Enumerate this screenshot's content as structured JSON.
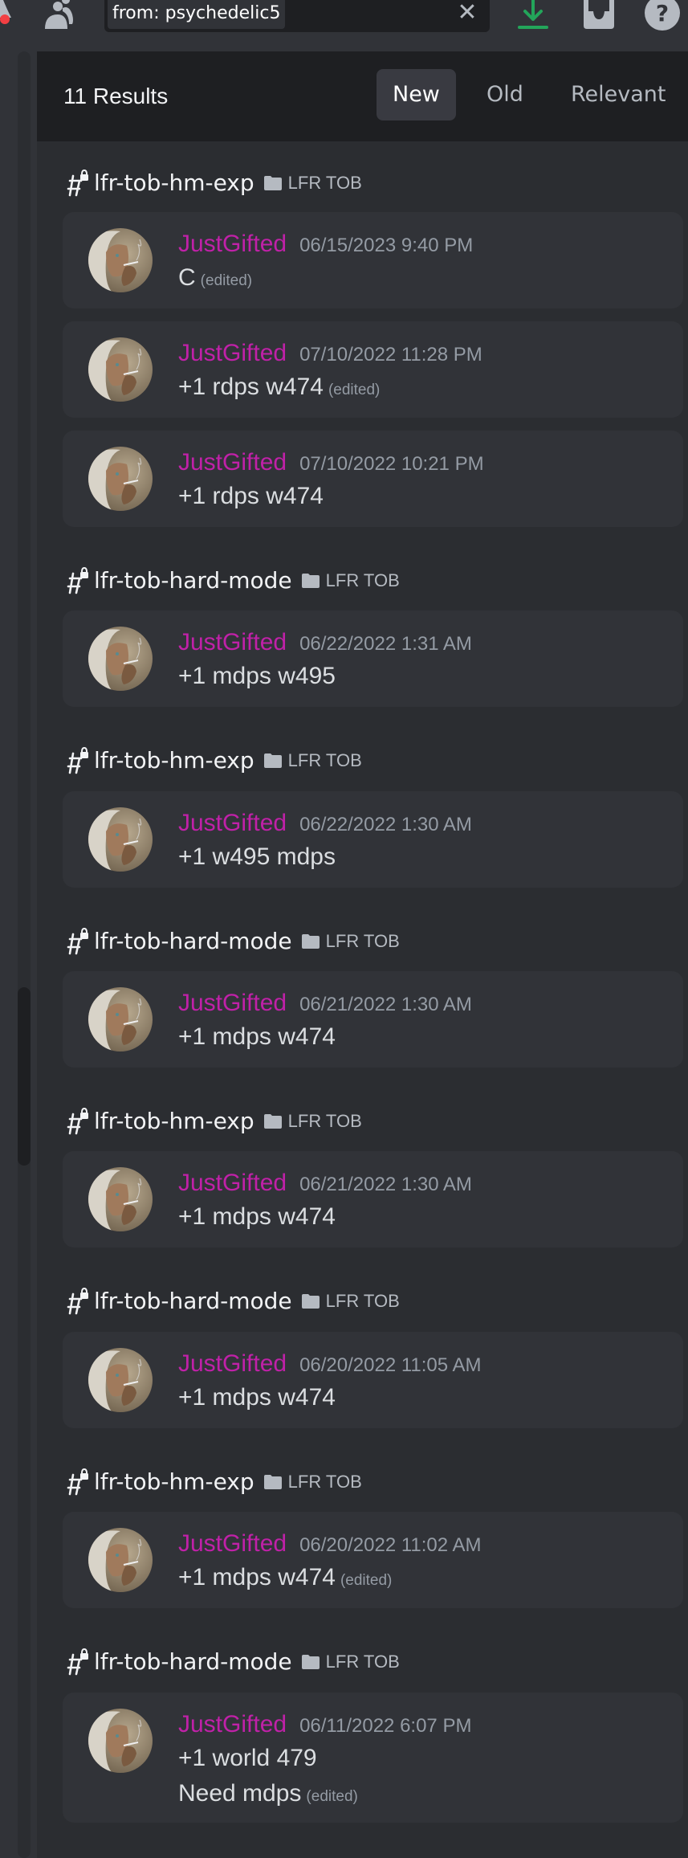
{
  "topbar": {
    "search_query": "from: psychedelic5",
    "clear_symbol": "✕",
    "icons": [
      "bell-icon",
      "members-icon",
      "download-icon",
      "inbox-icon",
      "help-icon"
    ]
  },
  "results": {
    "count_label": "11 Results",
    "sort_options": [
      {
        "label": "New",
        "active": true
      },
      {
        "label": "Old",
        "active": false
      },
      {
        "label": "Relevant",
        "active": false
      }
    ]
  },
  "colors": {
    "author": "#c021a8",
    "accent_green": "#23a55a",
    "notification": "#f23f43"
  },
  "groups": [
    {
      "channel": "lfr-tob-hm-exp",
      "category": "LFR TOB",
      "messages": [
        {
          "author": "JustGifted",
          "timestamp": "06/15/2023 9:40 PM",
          "lines": [
            "C"
          ],
          "edited": "(edited)"
        },
        {
          "author": "JustGifted",
          "timestamp": "07/10/2022 11:28 PM",
          "lines": [
            "+1 rdps w474"
          ],
          "edited": "(edited)"
        },
        {
          "author": "JustGifted",
          "timestamp": "07/10/2022 10:21 PM",
          "lines": [
            "+1 rdps w474"
          ],
          "edited": ""
        }
      ]
    },
    {
      "channel": "lfr-tob-hard-mode",
      "category": "LFR TOB",
      "messages": [
        {
          "author": "JustGifted",
          "timestamp": "06/22/2022 1:31 AM",
          "lines": [
            "+1 mdps w495"
          ],
          "edited": ""
        }
      ]
    },
    {
      "channel": "lfr-tob-hm-exp",
      "category": "LFR TOB",
      "messages": [
        {
          "author": "JustGifted",
          "timestamp": "06/22/2022 1:30 AM",
          "lines": [
            "+1 w495 mdps"
          ],
          "edited": ""
        }
      ]
    },
    {
      "channel": "lfr-tob-hard-mode",
      "category": "LFR TOB",
      "messages": [
        {
          "author": "JustGifted",
          "timestamp": "06/21/2022 1:30 AM",
          "lines": [
            "+1 mdps w474"
          ],
          "edited": ""
        }
      ]
    },
    {
      "channel": "lfr-tob-hm-exp",
      "category": "LFR TOB",
      "messages": [
        {
          "author": "JustGifted",
          "timestamp": "06/21/2022 1:30 AM",
          "lines": [
            "+1 mdps w474"
          ],
          "edited": ""
        }
      ]
    },
    {
      "channel": "lfr-tob-hard-mode",
      "category": "LFR TOB",
      "messages": [
        {
          "author": "JustGifted",
          "timestamp": "06/20/2022 11:05 AM",
          "lines": [
            "+1 mdps w474"
          ],
          "edited": ""
        }
      ]
    },
    {
      "channel": "lfr-tob-hm-exp",
      "category": "LFR TOB",
      "messages": [
        {
          "author": "JustGifted",
          "timestamp": "06/20/2022 11:02 AM",
          "lines": [
            "+1 mdps w474"
          ],
          "edited": "(edited)"
        }
      ]
    },
    {
      "channel": "lfr-tob-hard-mode",
      "category": "LFR TOB",
      "messages": [
        {
          "author": "JustGifted",
          "timestamp": "06/11/2022 6:07 PM",
          "lines": [
            "+1 world 479",
            "Need mdps"
          ],
          "edited": "(edited)"
        }
      ]
    }
  ]
}
